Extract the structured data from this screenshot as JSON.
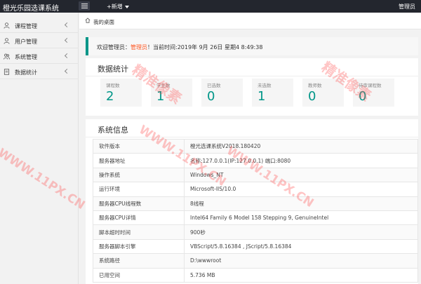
{
  "topbar": {
    "brand": "橙光乐园选课系统",
    "new_label": "+新增",
    "user_label": "管理员"
  },
  "sidebar": {
    "items": [
      {
        "label": "课程管理",
        "icon": "user-icon"
      },
      {
        "label": "用户管理",
        "icon": "user-icon"
      },
      {
        "label": "系统管理",
        "icon": "users-icon"
      },
      {
        "label": "数据统计",
        "icon": "document-icon"
      }
    ]
  },
  "tab": {
    "title": "我的桌面"
  },
  "welcome": {
    "prefix": "欢迎管理员：",
    "role": "管理员",
    "suffix": "！当前时间:2019年 9月 26日 星期4 8:49:38"
  },
  "stats": {
    "title": "数据统计",
    "items": [
      {
        "label": "课程数",
        "value": "2"
      },
      {
        "label": "学生数",
        "value": "1"
      },
      {
        "label": "已选数",
        "value": "0"
      },
      {
        "label": "未选数",
        "value": "1"
      },
      {
        "label": "教师数",
        "value": "0"
      },
      {
        "label": "待审课程数",
        "value": "0"
      }
    ]
  },
  "sysinfo": {
    "title": "系统信息",
    "rows": [
      {
        "key": "软件版本",
        "value": "橙光选课系统V2018.180420"
      },
      {
        "key": "服务器地址",
        "value": "名称:127.0.0.1(IP:127.0.0.1) 端口:8080"
      },
      {
        "key": "操作系统",
        "value": "Windows_NT"
      },
      {
        "key": "运行环境",
        "value": "Microsoft-IIS/10.0"
      },
      {
        "key": "服务器CPU线程数",
        "value": "8线程"
      },
      {
        "key": "服务器CPU详情",
        "value": "Intel64 Family 6 Model 158 Stepping 9, GenuineIntel"
      },
      {
        "key": "脚本超时时间",
        "value": "900秒"
      },
      {
        "key": "服务器脚本引擎",
        "value": "VBScript/5.8.16384 , JScript/5.8.16384"
      },
      {
        "key": "系统路径",
        "value": "D:\\wwwroot"
      },
      {
        "key": "已用空间",
        "value": "5.736 MB"
      }
    ]
  },
  "watermarks": [
    "精准像素",
    "WWW.11PX.CN",
    "精准像素",
    "WWW.11PX.CN",
    "精准像素"
  ],
  "colors": {
    "accent": "#009688",
    "topbar": "#23262e",
    "role": "#ff5722"
  }
}
